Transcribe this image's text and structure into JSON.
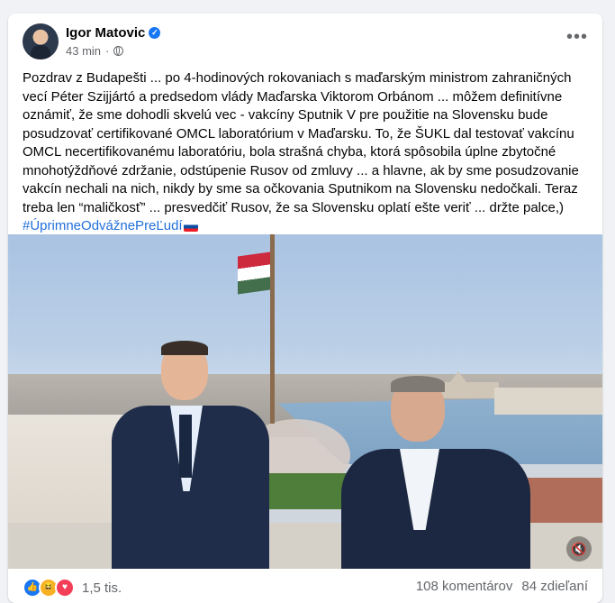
{
  "post": {
    "author": "Igor Matovic",
    "time": "43 min",
    "paragraph": "Pozdrav z Budapešti ... po 4-hodinových rokovaniach s maďarským ministrom zahraničných vecí Péter Szijjártó a predsedom vlády Maďarska Viktorom Orbánom ... môžem definitívne oznámiť, že sme dohodli skvelú vec - vakcíny Sputnik V pre použitie na Slovensku bude posudzovať certifikované OMCL laboratórium v Maďarsku. To, že ŠUKL dal testovať vakcínu OMCL necertifikovanému laboratóriu, bola strašná chyba, ktorá spôsobila úplne zbytočné mnohotýždňové zdržanie, odstúpenie Rusov od zmluvy ... a hlavne, ak by sme posudzovanie vakcín nechali na nich, nikdy by sme sa očkovania Sputnikom na Slovensku nedočkali. Teraz treba len “maličkosť” ... presvedčiť Rusov, že sa Slovensku oplatí ešte veriť ... držte palce,)",
    "hashtag": "#ÚprimneOdvážnePreĽudí"
  },
  "icons": {
    "verified": "verified-badge-icon",
    "privacy": "globe-icon",
    "more": "more-options-icon",
    "mute": "muted-speaker-icon"
  },
  "glyphs": {
    "verified": "✓",
    "more": "•••",
    "mute": "🔇",
    "like": "👍",
    "haha": "😆",
    "love": "♥"
  },
  "footer": {
    "reaction_count": "1,5 tis.",
    "comments": "108 komentárov",
    "shares": "84 zdieľaní"
  },
  "colors": {
    "like": "#1877f2",
    "haha": "#f7b125",
    "love": "#f33e58",
    "link": "#216fdb",
    "verified": "#1877f2"
  }
}
